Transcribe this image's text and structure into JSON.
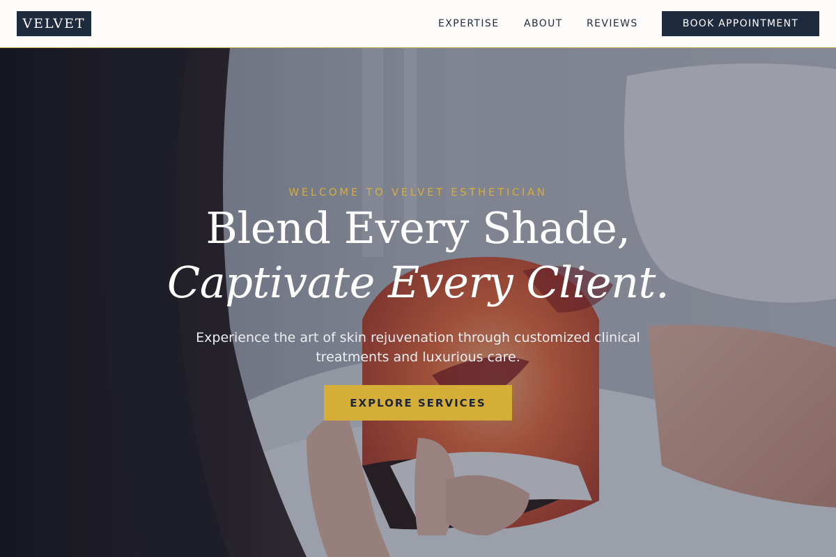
{
  "brand": {
    "logo_text": "VELVET"
  },
  "nav": {
    "items": [
      "EXPERTISE",
      "ABOUT",
      "REVIEWS"
    ],
    "cta_label": "BOOK APPOINTMENT"
  },
  "hero": {
    "eyebrow": "WELCOME TO VELVET ESTHETICIAN",
    "title_line1": "Blend Every Shade,",
    "title_line2": "Captivate Every Client.",
    "subtitle": "Experience the art of skin rejuvenation through customized clinical treatments and luxurious care.",
    "button_label": "EXPLORE SERVICES"
  },
  "colors": {
    "navy": "#1e2a3d",
    "gold": "#d4ae36",
    "header_bg": "#fdfcfb"
  }
}
